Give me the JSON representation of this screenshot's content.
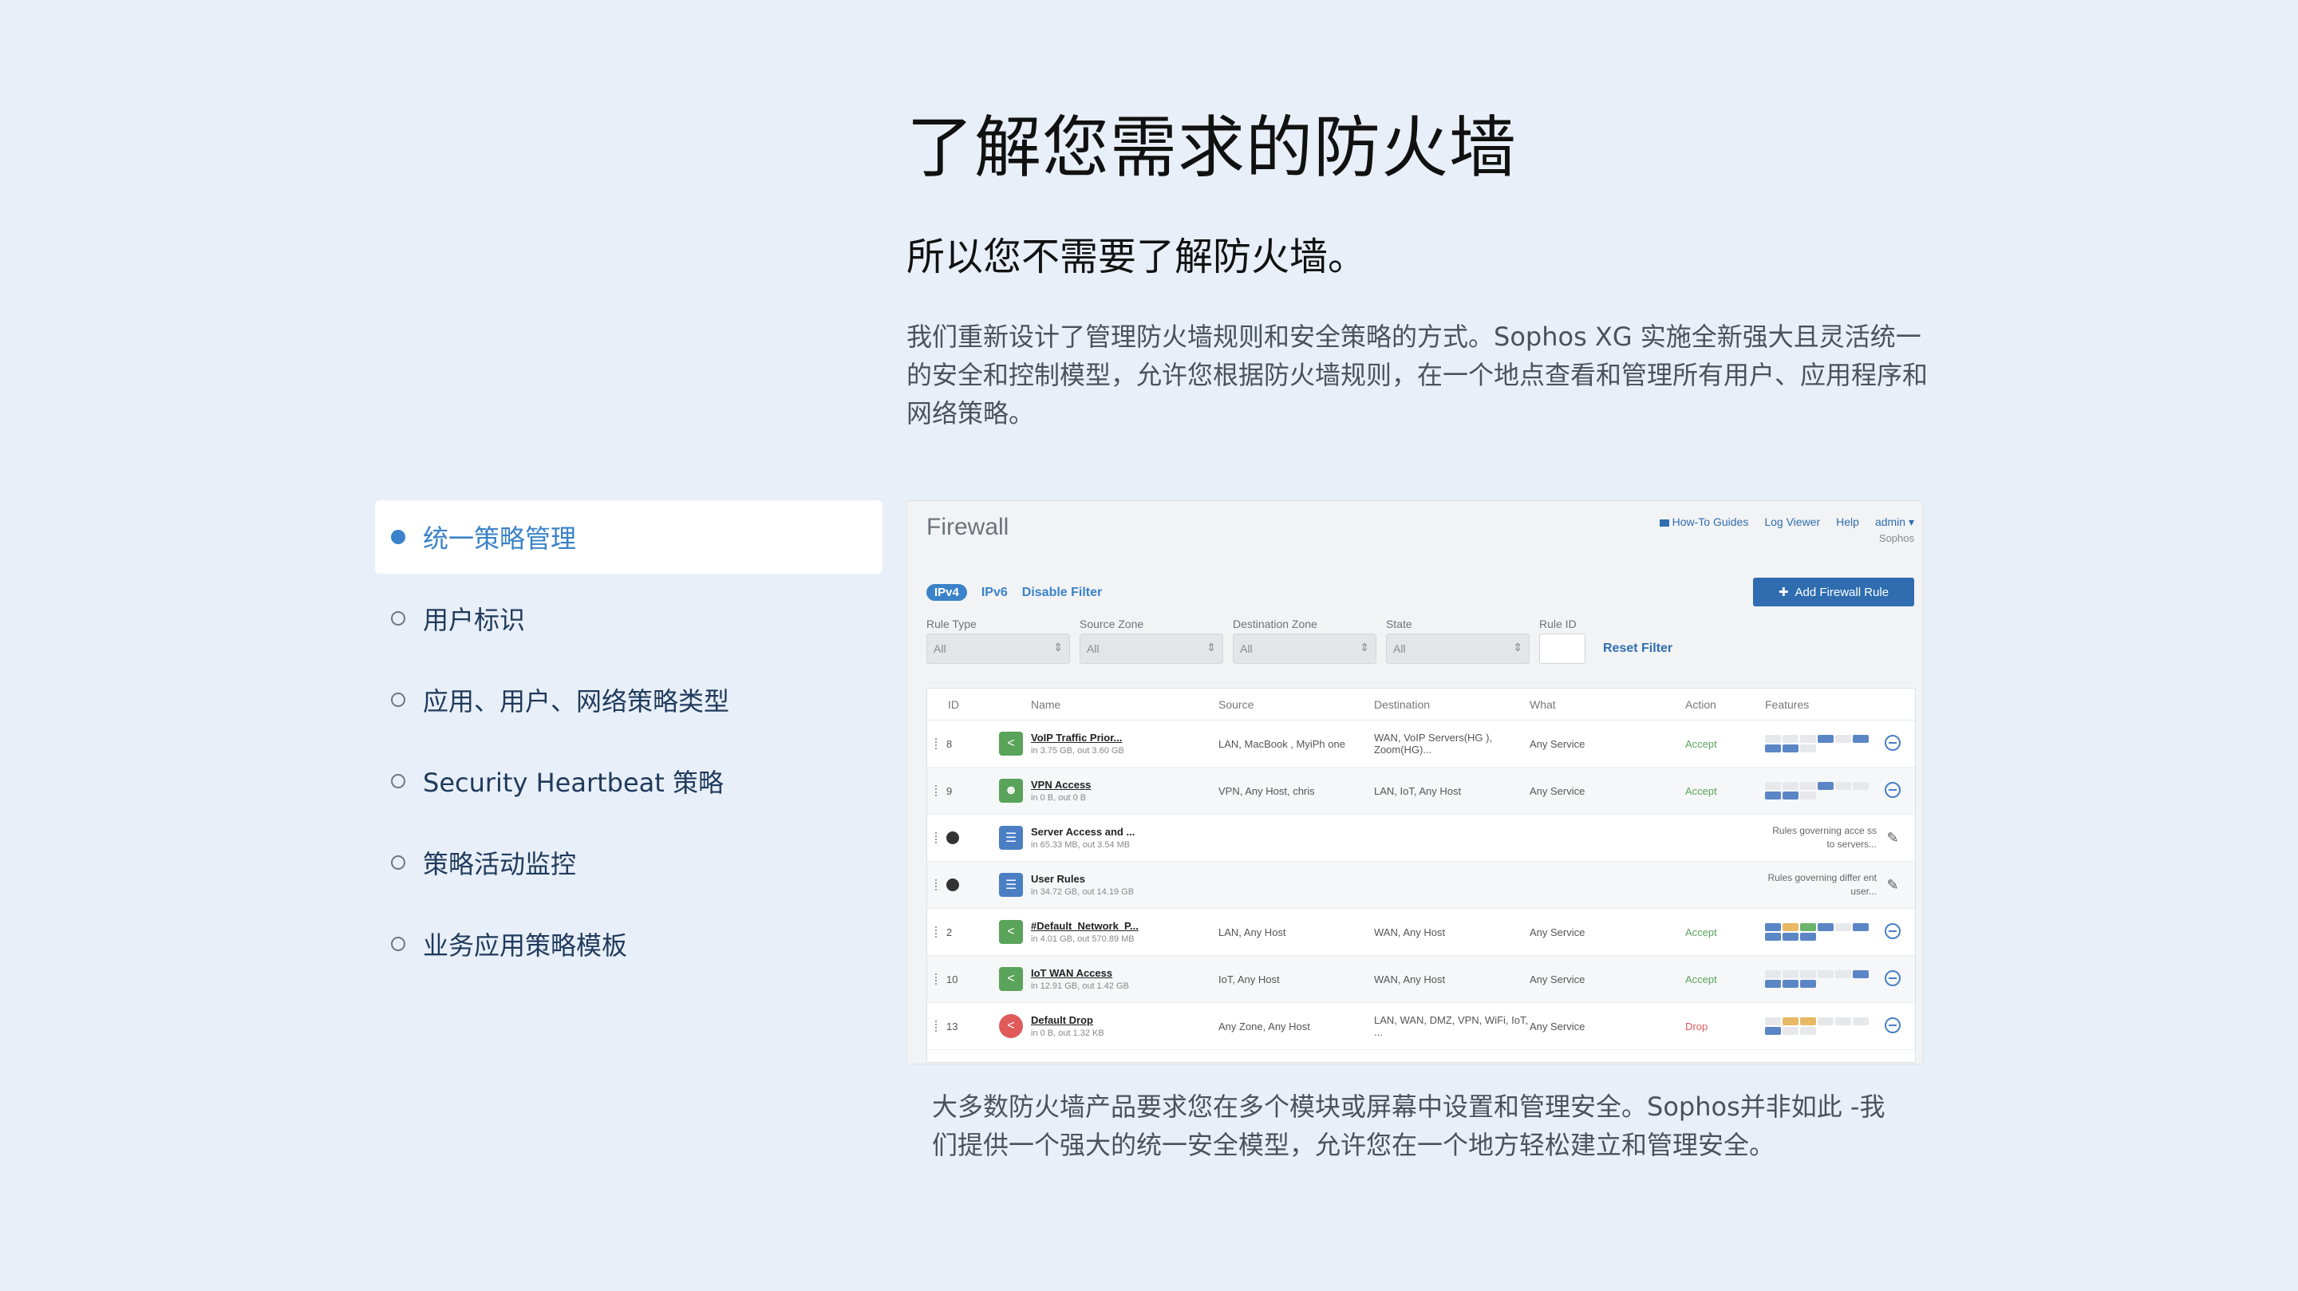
{
  "hero": {
    "title": "了解您需求的防火墙",
    "subtitle": "所以您不需要了解防火墙。",
    "description": "我们重新设计了管理防火墙规则和安全策略的方式。Sophos XG 实施全新强大且灵活统一的安全和控制模型，允许您根据防火墙规则，在一个地点查看和管理所有用户、应用程序和网络策略。"
  },
  "nav": {
    "items": [
      {
        "label": "统一策略管理",
        "active": true
      },
      {
        "label": "用户标识"
      },
      {
        "label": "应用、用户、网络策略类型"
      },
      {
        "label": "Security Heartbeat 策略"
      },
      {
        "label": "策略活动监控"
      },
      {
        "label": "业务应用策略模板"
      }
    ]
  },
  "caption": "大多数防火墙产品要求您在多个模块或屏幕中设置和管理安全。Sophos并非如此 -我们提供一个强大的统一安全模型，允许您在一个地方轻松建立和管理安全。",
  "firewall": {
    "title": "Firewall",
    "toplinks": {
      "guides": "How-To Guides",
      "log_viewer": "Log Viewer",
      "help": "Help",
      "admin": "admin ▾",
      "org": "Sophos"
    },
    "tabs": {
      "ipv4": "IPv4",
      "ipv6": "IPv6",
      "disable_filter": "Disable Filter"
    },
    "add_rule": "Add Firewall Rule",
    "filters": {
      "rule_type": "Rule Type",
      "source_zone": "Source Zone",
      "destination_zone": "Destination Zone",
      "state": "State",
      "rule_id": "Rule ID",
      "all": "All",
      "reset": "Reset Filter"
    },
    "columns": {
      "id": "ID",
      "name": "Name",
      "source": "Source",
      "destination": "Destination",
      "what": "What",
      "action": "Action",
      "features": "Features"
    },
    "rows": [
      {
        "id": "8",
        "name": "VoIP Traffic Prior...",
        "traffic": "in 3.75 GB, out 3.60 GB",
        "source": "LAN, MacBook , MyiPh one",
        "destination": "WAN, VoIP Servers(HG ), Zoom(HG)...",
        "what": "Any Service",
        "action": "Accept"
      },
      {
        "id": "9",
        "name": "VPN Access",
        "traffic": "in 0 B, out 0 B",
        "source": "VPN, Any Host, chris",
        "destination": "LAN, IoT, Any Host",
        "what": "Any Service",
        "action": "Accept"
      },
      {
        "id": "",
        "name": "Server Access and ...",
        "traffic": "in 65.33 MB, out 3.54 MB",
        "note": "Rules governing acce ss to servers..."
      },
      {
        "id": "",
        "name": "User Rules",
        "traffic": "in 34.72 GB, out 14.19 GB",
        "note": "Rules governing differ ent user..."
      },
      {
        "id": "2",
        "name": "#Default_Network_P...",
        "traffic": "in 4.01 GB, out 570.89 MB",
        "source": "LAN, Any Host",
        "destination": "WAN, Any Host",
        "what": "Any Service",
        "action": "Accept"
      },
      {
        "id": "10",
        "name": "IoT WAN Access",
        "traffic": "in 12.91 GB, out 1.42 GB",
        "source": "IoT, Any Host",
        "destination": "WAN, Any Host",
        "what": "Any Service",
        "action": "Accept"
      },
      {
        "id": "13",
        "name": "Default Drop",
        "traffic": "in 0 B, out 1.32 KB",
        "source": "Any Zone, Any Host",
        "destination": "LAN, WAN, DMZ, VPN, WiFi, IoT, ...",
        "what": "Any Service",
        "action": "Drop"
      }
    ]
  }
}
